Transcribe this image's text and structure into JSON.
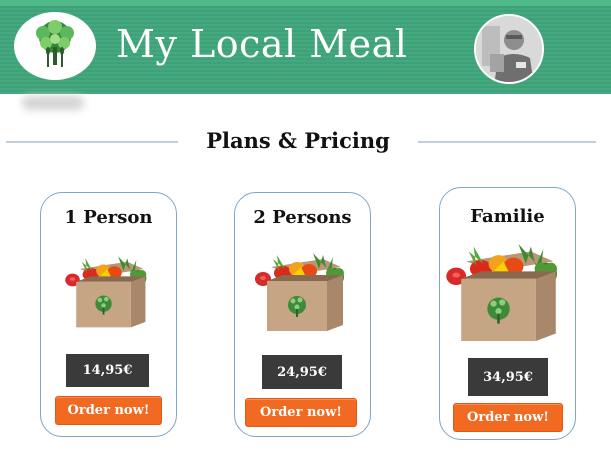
{
  "header": {
    "title": "My Local Meal",
    "logo_icon": "tree-fork-knife-logo",
    "avatar_icon": "user-avatar-photo"
  },
  "colors": {
    "brand_green": "#3fa57a",
    "accent_orange": "#f26a21",
    "price_dark": "#3a3a3a",
    "card_border": "#7da6c8"
  },
  "section": {
    "title": "Plans & Pricing"
  },
  "plans": [
    {
      "name": "1 Person",
      "price": "14,95€",
      "button": "Order now!",
      "image_icon": "vegetable-box-image"
    },
    {
      "name": "2 Persons",
      "price": "24,95€",
      "button": "Order now!",
      "image_icon": "vegetable-box-image"
    },
    {
      "name": "Familie",
      "price": "34,95€",
      "button": "Order now!",
      "image_icon": "vegetable-box-image"
    }
  ]
}
